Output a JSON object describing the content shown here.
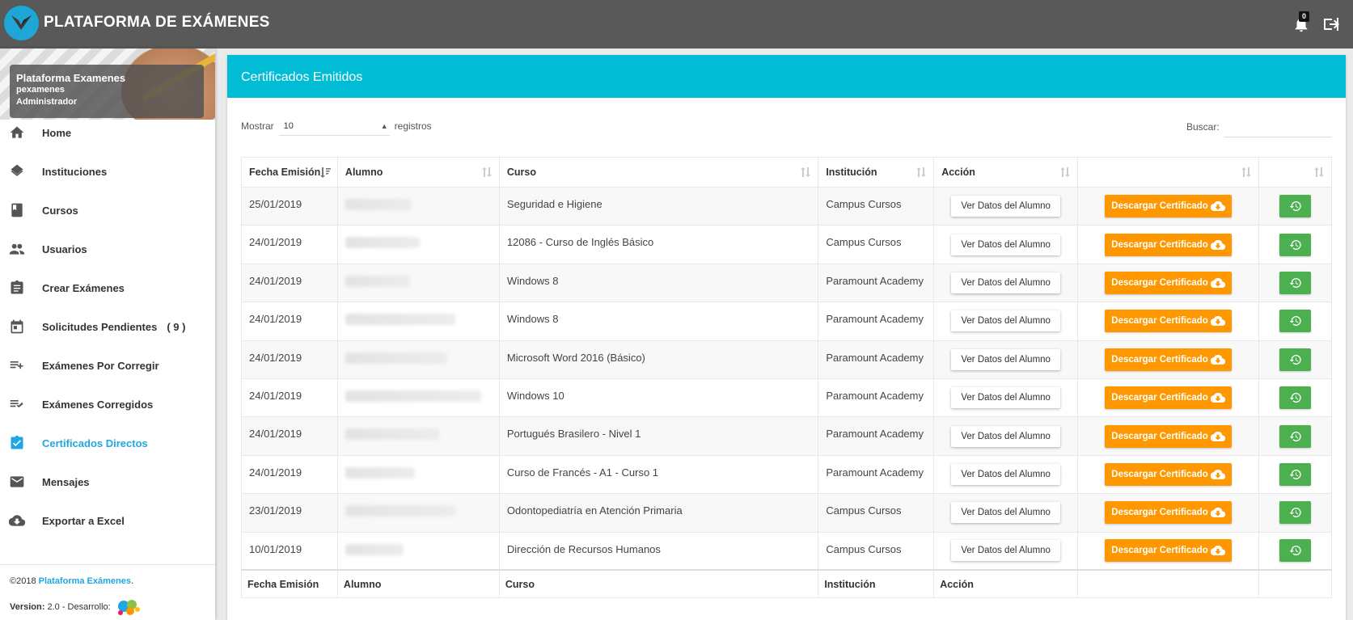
{
  "app": {
    "brand": "PLATAFORMA DE EXÁMENES",
    "notification_count": "0"
  },
  "profile": {
    "name": "Plataforma Examenes",
    "username": "pexamenes",
    "role": "Administrador"
  },
  "sidebar": {
    "items": [
      {
        "label": "Home",
        "icon": "home-icon"
      },
      {
        "label": "Instituciones",
        "icon": "layers-icon"
      },
      {
        "label": "Cursos",
        "icon": "book-icon"
      },
      {
        "label": "Usuarios",
        "icon": "people-icon"
      },
      {
        "label": "Crear Exámenes",
        "icon": "clipboard-icon"
      },
      {
        "label": "Solicitudes Pendientes",
        "count": "( 9 )",
        "icon": "calendar-icon"
      },
      {
        "label": "Exámenes Por Corregir",
        "icon": "playlist-add-icon"
      },
      {
        "label": "Exámenes Corregidos",
        "icon": "playlist-check-icon"
      },
      {
        "label": "Certificados Directos",
        "icon": "assignment-check-icon",
        "active": true
      },
      {
        "label": "Mensajes",
        "icon": "email-icon"
      },
      {
        "label": "Exportar a Excel",
        "icon": "cloud-download-icon"
      }
    ]
  },
  "footer": {
    "copyright": "©2018",
    "brand_link": "Plataforma Exámenes",
    "dot": ".",
    "version_label": "Version:",
    "version_value": "2.0 - Desarrollo:"
  },
  "card": {
    "title": "Certificados Emitidos"
  },
  "controls": {
    "show_label": "Mostrar",
    "page_size": "10",
    "records_label": "registros",
    "search_label": "Buscar:"
  },
  "table": {
    "headers": [
      "Fecha Emisión",
      "Alumno",
      "Curso",
      "Institución",
      "Acción",
      "",
      ""
    ],
    "footers": [
      "Fecha Emisión",
      "Alumno",
      "Curso",
      "Institución",
      "Acción",
      "",
      ""
    ],
    "view_label": "Ver Datos del Alumno",
    "download_label": "Descargar Certificado",
    "rows": [
      {
        "fecha": "25/01/2019",
        "curso": "Seguridad e Higiene",
        "institucion": "Campus Cursos"
      },
      {
        "fecha": "24/01/2019",
        "curso": "12086 - Curso de Inglés Básico",
        "institucion": "Campus Cursos"
      },
      {
        "fecha": "24/01/2019",
        "curso": "Windows 8",
        "institucion": "Paramount Academy"
      },
      {
        "fecha": "24/01/2019",
        "curso": "Windows 8",
        "institucion": "Paramount Academy"
      },
      {
        "fecha": "24/01/2019",
        "curso": "Microsoft Word 2016 (Básico)",
        "institucion": "Paramount Academy"
      },
      {
        "fecha": "24/01/2019",
        "curso": "Windows 10",
        "institucion": "Paramount Academy"
      },
      {
        "fecha": "24/01/2019",
        "curso": "Portugués Brasilero - Nivel 1",
        "institucion": "Paramount Academy"
      },
      {
        "fecha": "24/01/2019",
        "curso": "Curso de Francés - A1 - Curso 1",
        "institucion": "Paramount Academy"
      },
      {
        "fecha": "23/01/2019",
        "curso": "Odontopediatría en Atención Primaria",
        "institucion": "Campus Cursos"
      },
      {
        "fecha": "10/01/2019",
        "curso": "Dirección de Recursos Humanos",
        "institucion": "Campus Cursos"
      }
    ]
  },
  "colors": {
    "topbar": "#595959",
    "header": "#00bcd4",
    "accent": "#1ea7e0",
    "download": "#ff9800",
    "regen": "#4caf50"
  }
}
